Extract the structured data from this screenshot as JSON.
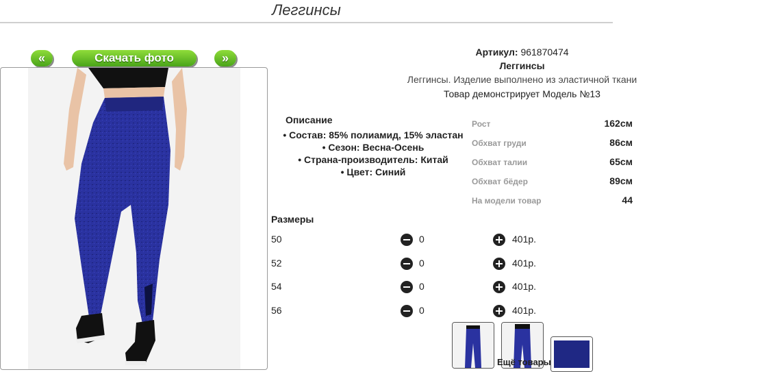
{
  "product": {
    "title": "Леггинсы",
    "sku_label": "Артикул:",
    "sku_value": "961870474",
    "name": "Леггинсы",
    "short_desc": "Леггинсы. Изделие выполнено из эластичной ткани",
    "model_note": "Товар демонстрирует Модель №13"
  },
  "gallery": {
    "prev_label": "«",
    "download_label": "Скачать фото",
    "next_label": "»"
  },
  "description": {
    "heading": "Описание",
    "items": [
      "• Состав: 85% полиамид, 15% эластан",
      "• Сезон: Весна-Осень",
      "• Страна-производитель: Китай",
      "• Цвет: Синий"
    ]
  },
  "measurements": [
    {
      "label": "Рост",
      "value": "162см"
    },
    {
      "label": "Обхват груди",
      "value": "86см"
    },
    {
      "label": "Обхват талии",
      "value": "65см"
    },
    {
      "label": "Обхват бёдер",
      "value": "89см"
    },
    {
      "label": "На модели товар",
      "value": "44"
    }
  ],
  "sizes": {
    "heading": "Размеры",
    "rows": [
      {
        "size": "50",
        "qty": "0",
        "price": "401р."
      },
      {
        "size": "52",
        "qty": "0",
        "price": "401р."
      },
      {
        "size": "54",
        "qty": "0",
        "price": "401р."
      },
      {
        "size": "56",
        "qty": "0",
        "price": "401р."
      }
    ]
  },
  "more_label": "Ещё товары",
  "colors": {
    "button": "#5cb524",
    "leggings": "#2a32a0",
    "text": "#222222"
  },
  "icons": [
    "minus-circle-icon",
    "plus-circle-icon"
  ]
}
